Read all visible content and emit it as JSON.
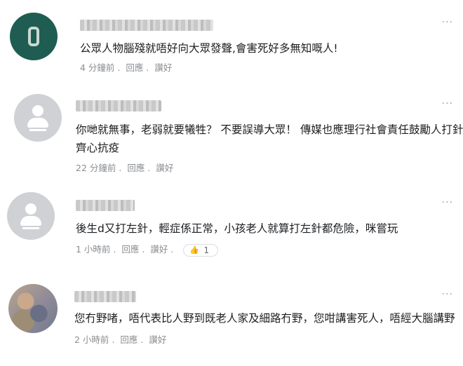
{
  "comments": [
    {
      "text": "公眾人物腦殘就唔好向大眾發聲,會害死好多無知嘅人!",
      "time": "4 分鐘前",
      "reply": "回應",
      "like": "讚好",
      "more": "···"
    },
    {
      "text_line1": "你哋就無事，老弱就要犧牲？ 不要誤導大眾！ 傳媒也應理行社會責任鼓勵人打針",
      "text_line2": "齊心抗疫",
      "time": "22 分鐘前",
      "reply": "回應",
      "like": "讚好",
      "more": "···"
    },
    {
      "text": "後生d又打左針，輕症係正常，小孩老人就算打左針都危險，咪嘗玩",
      "time": "1 小時前",
      "reply": "回應",
      "like": "讚好",
      "reaction_count": "1",
      "more": "···"
    },
    {
      "text": "您冇野啫，唔代表比人野到既老人家及細路冇野，您咁講害死人，唔經大腦講野",
      "time": "2 小時前",
      "reply": "回應",
      "like": "讚好",
      "more": "···"
    }
  ]
}
